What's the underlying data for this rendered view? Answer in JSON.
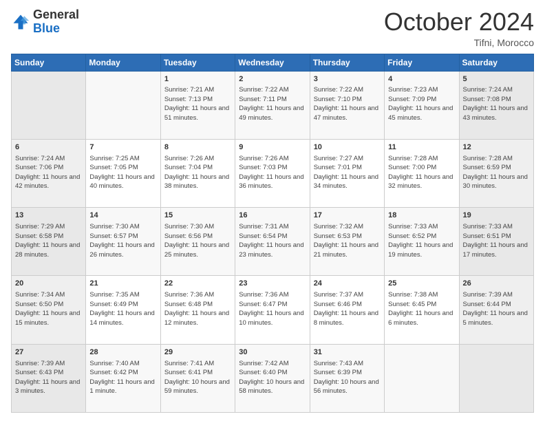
{
  "header": {
    "logo": {
      "general": "General",
      "blue": "Blue"
    },
    "title": "October 2024",
    "location": "Tifni, Morocco"
  },
  "weekdays": [
    "Sunday",
    "Monday",
    "Tuesday",
    "Wednesday",
    "Thursday",
    "Friday",
    "Saturday"
  ],
  "weeks": [
    [
      {
        "day": "",
        "info": ""
      },
      {
        "day": "",
        "info": ""
      },
      {
        "day": "1",
        "info": "Sunrise: 7:21 AM\nSunset: 7:13 PM\nDaylight: 11 hours and 51 minutes."
      },
      {
        "day": "2",
        "info": "Sunrise: 7:22 AM\nSunset: 7:11 PM\nDaylight: 11 hours and 49 minutes."
      },
      {
        "day": "3",
        "info": "Sunrise: 7:22 AM\nSunset: 7:10 PM\nDaylight: 11 hours and 47 minutes."
      },
      {
        "day": "4",
        "info": "Sunrise: 7:23 AM\nSunset: 7:09 PM\nDaylight: 11 hours and 45 minutes."
      },
      {
        "day": "5",
        "info": "Sunrise: 7:24 AM\nSunset: 7:08 PM\nDaylight: 11 hours and 43 minutes."
      }
    ],
    [
      {
        "day": "6",
        "info": "Sunrise: 7:24 AM\nSunset: 7:06 PM\nDaylight: 11 hours and 42 minutes."
      },
      {
        "day": "7",
        "info": "Sunrise: 7:25 AM\nSunset: 7:05 PM\nDaylight: 11 hours and 40 minutes."
      },
      {
        "day": "8",
        "info": "Sunrise: 7:26 AM\nSunset: 7:04 PM\nDaylight: 11 hours and 38 minutes."
      },
      {
        "day": "9",
        "info": "Sunrise: 7:26 AM\nSunset: 7:03 PM\nDaylight: 11 hours and 36 minutes."
      },
      {
        "day": "10",
        "info": "Sunrise: 7:27 AM\nSunset: 7:01 PM\nDaylight: 11 hours and 34 minutes."
      },
      {
        "day": "11",
        "info": "Sunrise: 7:28 AM\nSunset: 7:00 PM\nDaylight: 11 hours and 32 minutes."
      },
      {
        "day": "12",
        "info": "Sunrise: 7:28 AM\nSunset: 6:59 PM\nDaylight: 11 hours and 30 minutes."
      }
    ],
    [
      {
        "day": "13",
        "info": "Sunrise: 7:29 AM\nSunset: 6:58 PM\nDaylight: 11 hours and 28 minutes."
      },
      {
        "day": "14",
        "info": "Sunrise: 7:30 AM\nSunset: 6:57 PM\nDaylight: 11 hours and 26 minutes."
      },
      {
        "day": "15",
        "info": "Sunrise: 7:30 AM\nSunset: 6:56 PM\nDaylight: 11 hours and 25 minutes."
      },
      {
        "day": "16",
        "info": "Sunrise: 7:31 AM\nSunset: 6:54 PM\nDaylight: 11 hours and 23 minutes."
      },
      {
        "day": "17",
        "info": "Sunrise: 7:32 AM\nSunset: 6:53 PM\nDaylight: 11 hours and 21 minutes."
      },
      {
        "day": "18",
        "info": "Sunrise: 7:33 AM\nSunset: 6:52 PM\nDaylight: 11 hours and 19 minutes."
      },
      {
        "day": "19",
        "info": "Sunrise: 7:33 AM\nSunset: 6:51 PM\nDaylight: 11 hours and 17 minutes."
      }
    ],
    [
      {
        "day": "20",
        "info": "Sunrise: 7:34 AM\nSunset: 6:50 PM\nDaylight: 11 hours and 15 minutes."
      },
      {
        "day": "21",
        "info": "Sunrise: 7:35 AM\nSunset: 6:49 PM\nDaylight: 11 hours and 14 minutes."
      },
      {
        "day": "22",
        "info": "Sunrise: 7:36 AM\nSunset: 6:48 PM\nDaylight: 11 hours and 12 minutes."
      },
      {
        "day": "23",
        "info": "Sunrise: 7:36 AM\nSunset: 6:47 PM\nDaylight: 11 hours and 10 minutes."
      },
      {
        "day": "24",
        "info": "Sunrise: 7:37 AM\nSunset: 6:46 PM\nDaylight: 11 hours and 8 minutes."
      },
      {
        "day": "25",
        "info": "Sunrise: 7:38 AM\nSunset: 6:45 PM\nDaylight: 11 hours and 6 minutes."
      },
      {
        "day": "26",
        "info": "Sunrise: 7:39 AM\nSunset: 6:44 PM\nDaylight: 11 hours and 5 minutes."
      }
    ],
    [
      {
        "day": "27",
        "info": "Sunrise: 7:39 AM\nSunset: 6:43 PM\nDaylight: 11 hours and 3 minutes."
      },
      {
        "day": "28",
        "info": "Sunrise: 7:40 AM\nSunset: 6:42 PM\nDaylight: 11 hours and 1 minute."
      },
      {
        "day": "29",
        "info": "Sunrise: 7:41 AM\nSunset: 6:41 PM\nDaylight: 10 hours and 59 minutes."
      },
      {
        "day": "30",
        "info": "Sunrise: 7:42 AM\nSunset: 6:40 PM\nDaylight: 10 hours and 58 minutes."
      },
      {
        "day": "31",
        "info": "Sunrise: 7:43 AM\nSunset: 6:39 PM\nDaylight: 10 hours and 56 minutes."
      },
      {
        "day": "",
        "info": ""
      },
      {
        "day": "",
        "info": ""
      }
    ]
  ]
}
